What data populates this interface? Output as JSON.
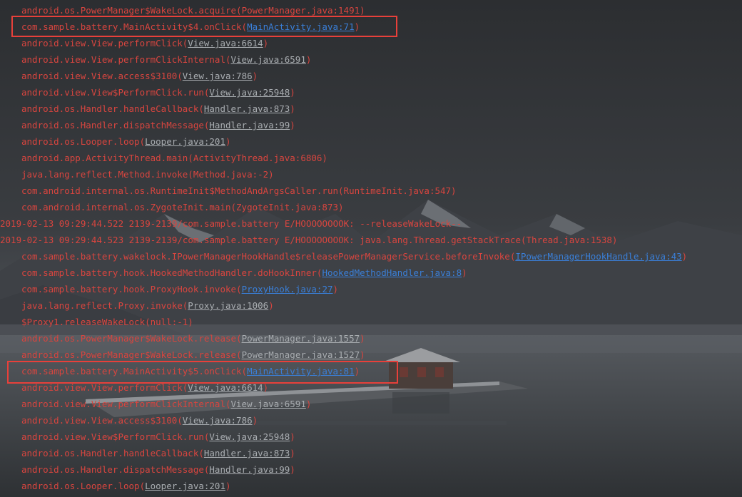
{
  "log_lines": [
    {
      "indent": true,
      "text": "android.os.PowerManager$WakeLock.acquire(",
      "link": "PowerManager.java:1491",
      "link_style": "plain",
      "tail": ")"
    },
    {
      "indent": true,
      "text": "com.sample.battery.MainActivity$4.onClick(",
      "link": "MainActivity.java:71",
      "link_style": "blue",
      "tail": ")",
      "highlight": true
    },
    {
      "indent": true,
      "text": "android.view.View.performClick(",
      "link": "View.java:6614",
      "link_style": "gray",
      "tail": ")"
    },
    {
      "indent": true,
      "text": "android.view.View.performClickInternal(",
      "link": "View.java:6591",
      "link_style": "gray",
      "tail": ")"
    },
    {
      "indent": true,
      "text": "android.view.View.access$3100(",
      "link": "View.java:786",
      "link_style": "gray",
      "tail": ")"
    },
    {
      "indent": true,
      "text": "android.view.View$PerformClick.run(",
      "link": "View.java:25948",
      "link_style": "gray",
      "tail": ")"
    },
    {
      "indent": true,
      "text": "android.os.Handler.handleCallback(",
      "link": "Handler.java:873",
      "link_style": "gray",
      "tail": ")"
    },
    {
      "indent": true,
      "text": "android.os.Handler.dispatchMessage(",
      "link": "Handler.java:99",
      "link_style": "gray",
      "tail": ")"
    },
    {
      "indent": true,
      "text": "android.os.Looper.loop(",
      "link": "Looper.java:201",
      "link_style": "gray",
      "tail": ")"
    },
    {
      "indent": true,
      "text": "android.app.ActivityThread.main(ActivityThread.java:6806)",
      "link": "",
      "link_style": "none",
      "tail": ""
    },
    {
      "indent": true,
      "text": "java.lang.reflect.Method.invoke(Method.java:-2)",
      "link": "",
      "link_style": "none",
      "tail": ""
    },
    {
      "indent": true,
      "text": "com.android.internal.os.RuntimeInit$MethodAndArgsCaller.run(RuntimeInit.java:547)",
      "link": "",
      "link_style": "none",
      "tail": ""
    },
    {
      "indent": true,
      "text": "com.android.internal.os.ZygoteInit.main(ZygoteInit.java:873)",
      "link": "",
      "link_style": "none",
      "tail": ""
    },
    {
      "indent": false,
      "text": "2019-02-13 09:29:44.522 2139-2139/com.sample.battery E/HOOOOOOOOK: --releaseWakeLock--",
      "link": "",
      "link_style": "none",
      "tail": ""
    },
    {
      "indent": false,
      "text": "2019-02-13 09:29:44.523 2139-2139/com.sample.battery E/HOOOOOOOOK: java.lang.Thread.getStackTrace(Thread.java:1538)",
      "link": "",
      "link_style": "none",
      "tail": ""
    },
    {
      "indent": true,
      "text": "com.sample.battery.wakelock.IPowerManagerHookHandle$releasePowerManagerService.beforeInvoke(",
      "link": "IPowerManagerHookHandle.java:43",
      "link_style": "blue",
      "tail": ")"
    },
    {
      "indent": true,
      "text": "com.sample.battery.hook.HookedMethodHandler.doHookInner(",
      "link": "HookedMethodHandler.java:8",
      "link_style": "blue",
      "tail": ")"
    },
    {
      "indent": true,
      "text": "com.sample.battery.hook.ProxyHook.invoke(",
      "link": "ProxyHook.java:27",
      "link_style": "blue",
      "tail": ")"
    },
    {
      "indent": true,
      "text": "java.lang.reflect.Proxy.invoke(",
      "link": "Proxy.java:1006",
      "link_style": "gray",
      "tail": ")"
    },
    {
      "indent": true,
      "text": "$Proxy1.releaseWakeLock(null:-1)",
      "link": "",
      "link_style": "none",
      "tail": ""
    },
    {
      "indent": true,
      "text": "android.os.PowerManager$WakeLock.release(",
      "link": "PowerManager.java:1557",
      "link_style": "gray",
      "tail": ")"
    },
    {
      "indent": true,
      "text": "android.os.PowerManager$WakeLock.release(",
      "link": "PowerManager.java:1527",
      "link_style": "gray",
      "tail": ")"
    },
    {
      "indent": true,
      "text": "com.sample.battery.MainActivity$5.onClick(",
      "link": "MainActivity.java:81",
      "link_style": "blue",
      "tail": ")",
      "highlight": true
    },
    {
      "indent": true,
      "text": "android.view.View.performClick(",
      "link": "View.java:6614",
      "link_style": "gray",
      "tail": ")"
    },
    {
      "indent": true,
      "text": "android.view.View.performClickInternal(",
      "link": "View.java:6591",
      "link_style": "gray",
      "tail": ")"
    },
    {
      "indent": true,
      "text": "android.view.View.access$3100(",
      "link": "View.java:786",
      "link_style": "gray",
      "tail": ")"
    },
    {
      "indent": true,
      "text": "android.view.View$PerformClick.run(",
      "link": "View.java:25948",
      "link_style": "gray",
      "tail": ")"
    },
    {
      "indent": true,
      "text": "android.os.Handler.handleCallback(",
      "link": "Handler.java:873",
      "link_style": "gray",
      "tail": ")"
    },
    {
      "indent": true,
      "text": "android.os.Handler.dispatchMessage(",
      "link": "Handler.java:99",
      "link_style": "gray",
      "tail": ")"
    },
    {
      "indent": true,
      "text": "android.os.Looper.loop(",
      "link": "Looper.java:201",
      "link_style": "gray",
      "tail": ")"
    }
  ],
  "colors": {
    "log_text": "#d8453f",
    "link_gray": "#a9adb1",
    "link_blue": "#3a7fd8",
    "highlight_border": "#e8403a"
  }
}
